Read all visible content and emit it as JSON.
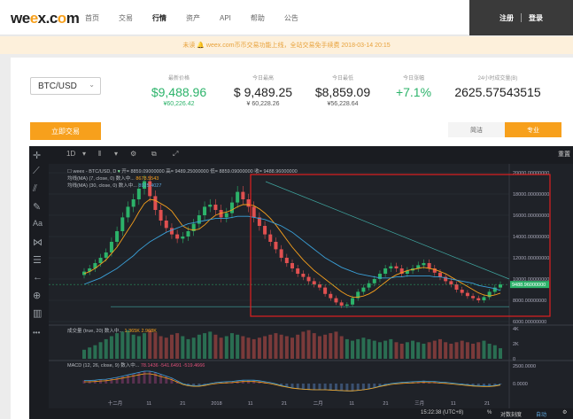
{
  "brand": {
    "logo_pre": "we",
    "logo_o": "e",
    "logo_post": "x.c",
    "logo_o2": "o",
    "logo_end": "m"
  },
  "nav": {
    "items": [
      "首页",
      "交易",
      "行情",
      "资产",
      "API",
      "帮助",
      "公告"
    ],
    "active": "行情",
    "register": "注册",
    "login": "登录"
  },
  "notice": "未读 🔔  weex.com币币交易功能上线，全站交易免手续费  2018-03-14 20:15",
  "market": {
    "pair": "BTC/USD",
    "stats": [
      {
        "label": "最新价格",
        "value": "$9,488.96",
        "sub": "¥60,226.42",
        "green": true
      },
      {
        "label": "今日最高",
        "value": "$ 9,489.25",
        "sub": "¥ 60,228.26",
        "green": false
      },
      {
        "label": "今日最低",
        "value": "$8,859.09",
        "sub": "¥56,228.64",
        "green": false
      },
      {
        "label": "今日涨幅",
        "value": "+7.1%",
        "sub": "",
        "green": true
      },
      {
        "label": "24小时成交量(B)",
        "value": "2625.57543515",
        "sub": "",
        "green": false
      }
    ],
    "buy_label": "立即交易",
    "mode_simple": "简洁",
    "mode_pro": "专业"
  },
  "toolbar": {
    "interval": "1D",
    "reset": "重置"
  },
  "legend": {
    "title": "weex - BTC/USD, D",
    "ohlc": "开= 8859.09000000 高= 9489.25000000 低= 8859.09000000 收= 9488.96000000",
    "ma7": "均线(MA) (7, close, 0) 数入中...",
    "ma7_val": "8678.5543",
    "ma30": "均线(MA) (30, close, 0) 数入中...",
    "ma30_val": "8925.4027",
    "volume": "成交量 (true, 20) 数入中...",
    "volume_vals": "1.365K  2.968K",
    "macd": "MACD (12, 26, close, 9) 数入中...",
    "macd_vals": "78.1436  -541.6491  -519.4666"
  },
  "bottombar": {
    "time": "15:22:38 (UTC+8)",
    "pct": "%",
    "log": "对数刻度",
    "auto": "自动"
  },
  "chart_data": {
    "type": "line",
    "title": "",
    "x_ticks": [
      "十二月",
      "11",
      "21",
      "2018",
      "11",
      "21",
      "二月",
      "11",
      "21",
      "三月",
      "11",
      "21"
    ],
    "y_ticks_price": [
      "20000.00000000",
      "18000.00000000",
      "16000.00000000",
      "14000.00000000",
      "12000.00000000",
      "10000.00000000",
      "8000.00000000",
      "6000.00000000"
    ],
    "price_label": "9488.96000000",
    "ylim": [
      6000,
      20500
    ],
    "y_ticks_volume": [
      "4K",
      "2K",
      "0"
    ],
    "y_ticks_macd": [
      "2500.0000",
      "0.0000"
    ],
    "close": [
      10700,
      11000,
      11500,
      12000,
      12500,
      13500,
      14500,
      15800,
      16800,
      17500,
      18500,
      19200,
      17800,
      16500,
      15500,
      14800,
      14200,
      13800,
      14000,
      14500,
      15200,
      16000,
      16800,
      17000,
      16500,
      15800,
      16200,
      17200,
      18200,
      17500,
      16800,
      15800,
      15000,
      14200,
      13500,
      12800,
      12000,
      11500,
      11000,
      10500,
      10200,
      9800,
      9500,
      9200,
      8600,
      8200,
      7800,
      7500,
      7600,
      8200,
      8800,
      9200,
      9600,
      10000,
      10500,
      11000,
      11200,
      11000,
      10500,
      10800,
      11000,
      11300,
      11500,
      11000,
      10600,
      10200,
      9800,
      9500,
      9000,
      8700,
      8400,
      8200,
      8000,
      8300,
      8800,
      9200,
      9488
    ],
    "ma7": [
      10500,
      10700,
      11000,
      11400,
      11800,
      12400,
      13000,
      13800,
      14600,
      15400,
      16300,
      17100,
      17500,
      17400,
      17100,
      16800,
      16400,
      15700,
      15000,
      14700,
      14600,
      14700,
      15100,
      15600,
      16000,
      16200,
      16300,
      16500,
      16800,
      17000,
      17000,
      16900,
      16600,
      16200,
      15700,
      15100,
      14400,
      13700,
      13000,
      12400,
      11800,
      11300,
      10800,
      10400,
      10000,
      9600,
      9200,
      8800,
      8500,
      8300,
      8300,
      8400,
      8600,
      8900,
      9300,
      9700,
      10100,
      10400,
      10600,
      10800,
      10900,
      11000,
      11100,
      11000,
      10900,
      10700,
      10500,
      10200,
      9900,
      9600,
      9300,
      9000,
      8700,
      8500,
      8400,
      8500,
      8678
    ],
    "ma30": [
      9500,
      9700,
      9900,
      10100,
      10400,
      10700,
      11000,
      11400,
      11800,
      12200,
      12700,
      13100,
      13500,
      13800,
      14100,
      14400,
      14600,
      14800,
      15000,
      15200,
      15300,
      15400,
      15500,
      15600,
      15700,
      15700,
      15700,
      15800,
      15900,
      15900,
      15900,
      15800,
      15700,
      15600,
      15400,
      15200,
      15000,
      14700,
      14400,
      14000,
      13600,
      13200,
      12800,
      12400,
      12000,
      11700,
      11400,
      11100,
      10900,
      10700,
      10500,
      10400,
      10300,
      10200,
      10100,
      10100,
      10100,
      10200,
      10200,
      10300,
      10300,
      10300,
      10300,
      10300,
      10200,
      10200,
      10100,
      10000,
      9900,
      9800,
      9700,
      9600,
      9400,
      9300,
      9200,
      9100,
      8925
    ],
    "volume": [
      1.2,
      1.5,
      1.8,
      2.2,
      2.6,
      3.0,
      3.4,
      3.6,
      3.8,
      3.2,
      3.0,
      3.4,
      3.8,
      3.5,
      3.0,
      2.8,
      3.2,
      3.4,
      3.0,
      2.6,
      2.8,
      3.2,
      3.4,
      3.6,
      3.2,
      2.8,
      3.0,
      3.4,
      3.2,
      3.0,
      2.8,
      2.6,
      2.8,
      3.0,
      3.2,
      3.4,
      3.2,
      3.0,
      2.8,
      3.2,
      3.6,
      3.8,
      3.4,
      3.0,
      3.2,
      3.4,
      3.6,
      3.0,
      2.6,
      2.4,
      2.6,
      2.8,
      2.6,
      2.4,
      2.2,
      2.4,
      2.6,
      2.2,
      2.0,
      2.2,
      2.4,
      2.2,
      2.0,
      2.2,
      2.4,
      2.6,
      2.2,
      2.0,
      2.2,
      2.4,
      2.2,
      2.0,
      2.2,
      2.4,
      2.0,
      1.8,
      1.4
    ]
  }
}
